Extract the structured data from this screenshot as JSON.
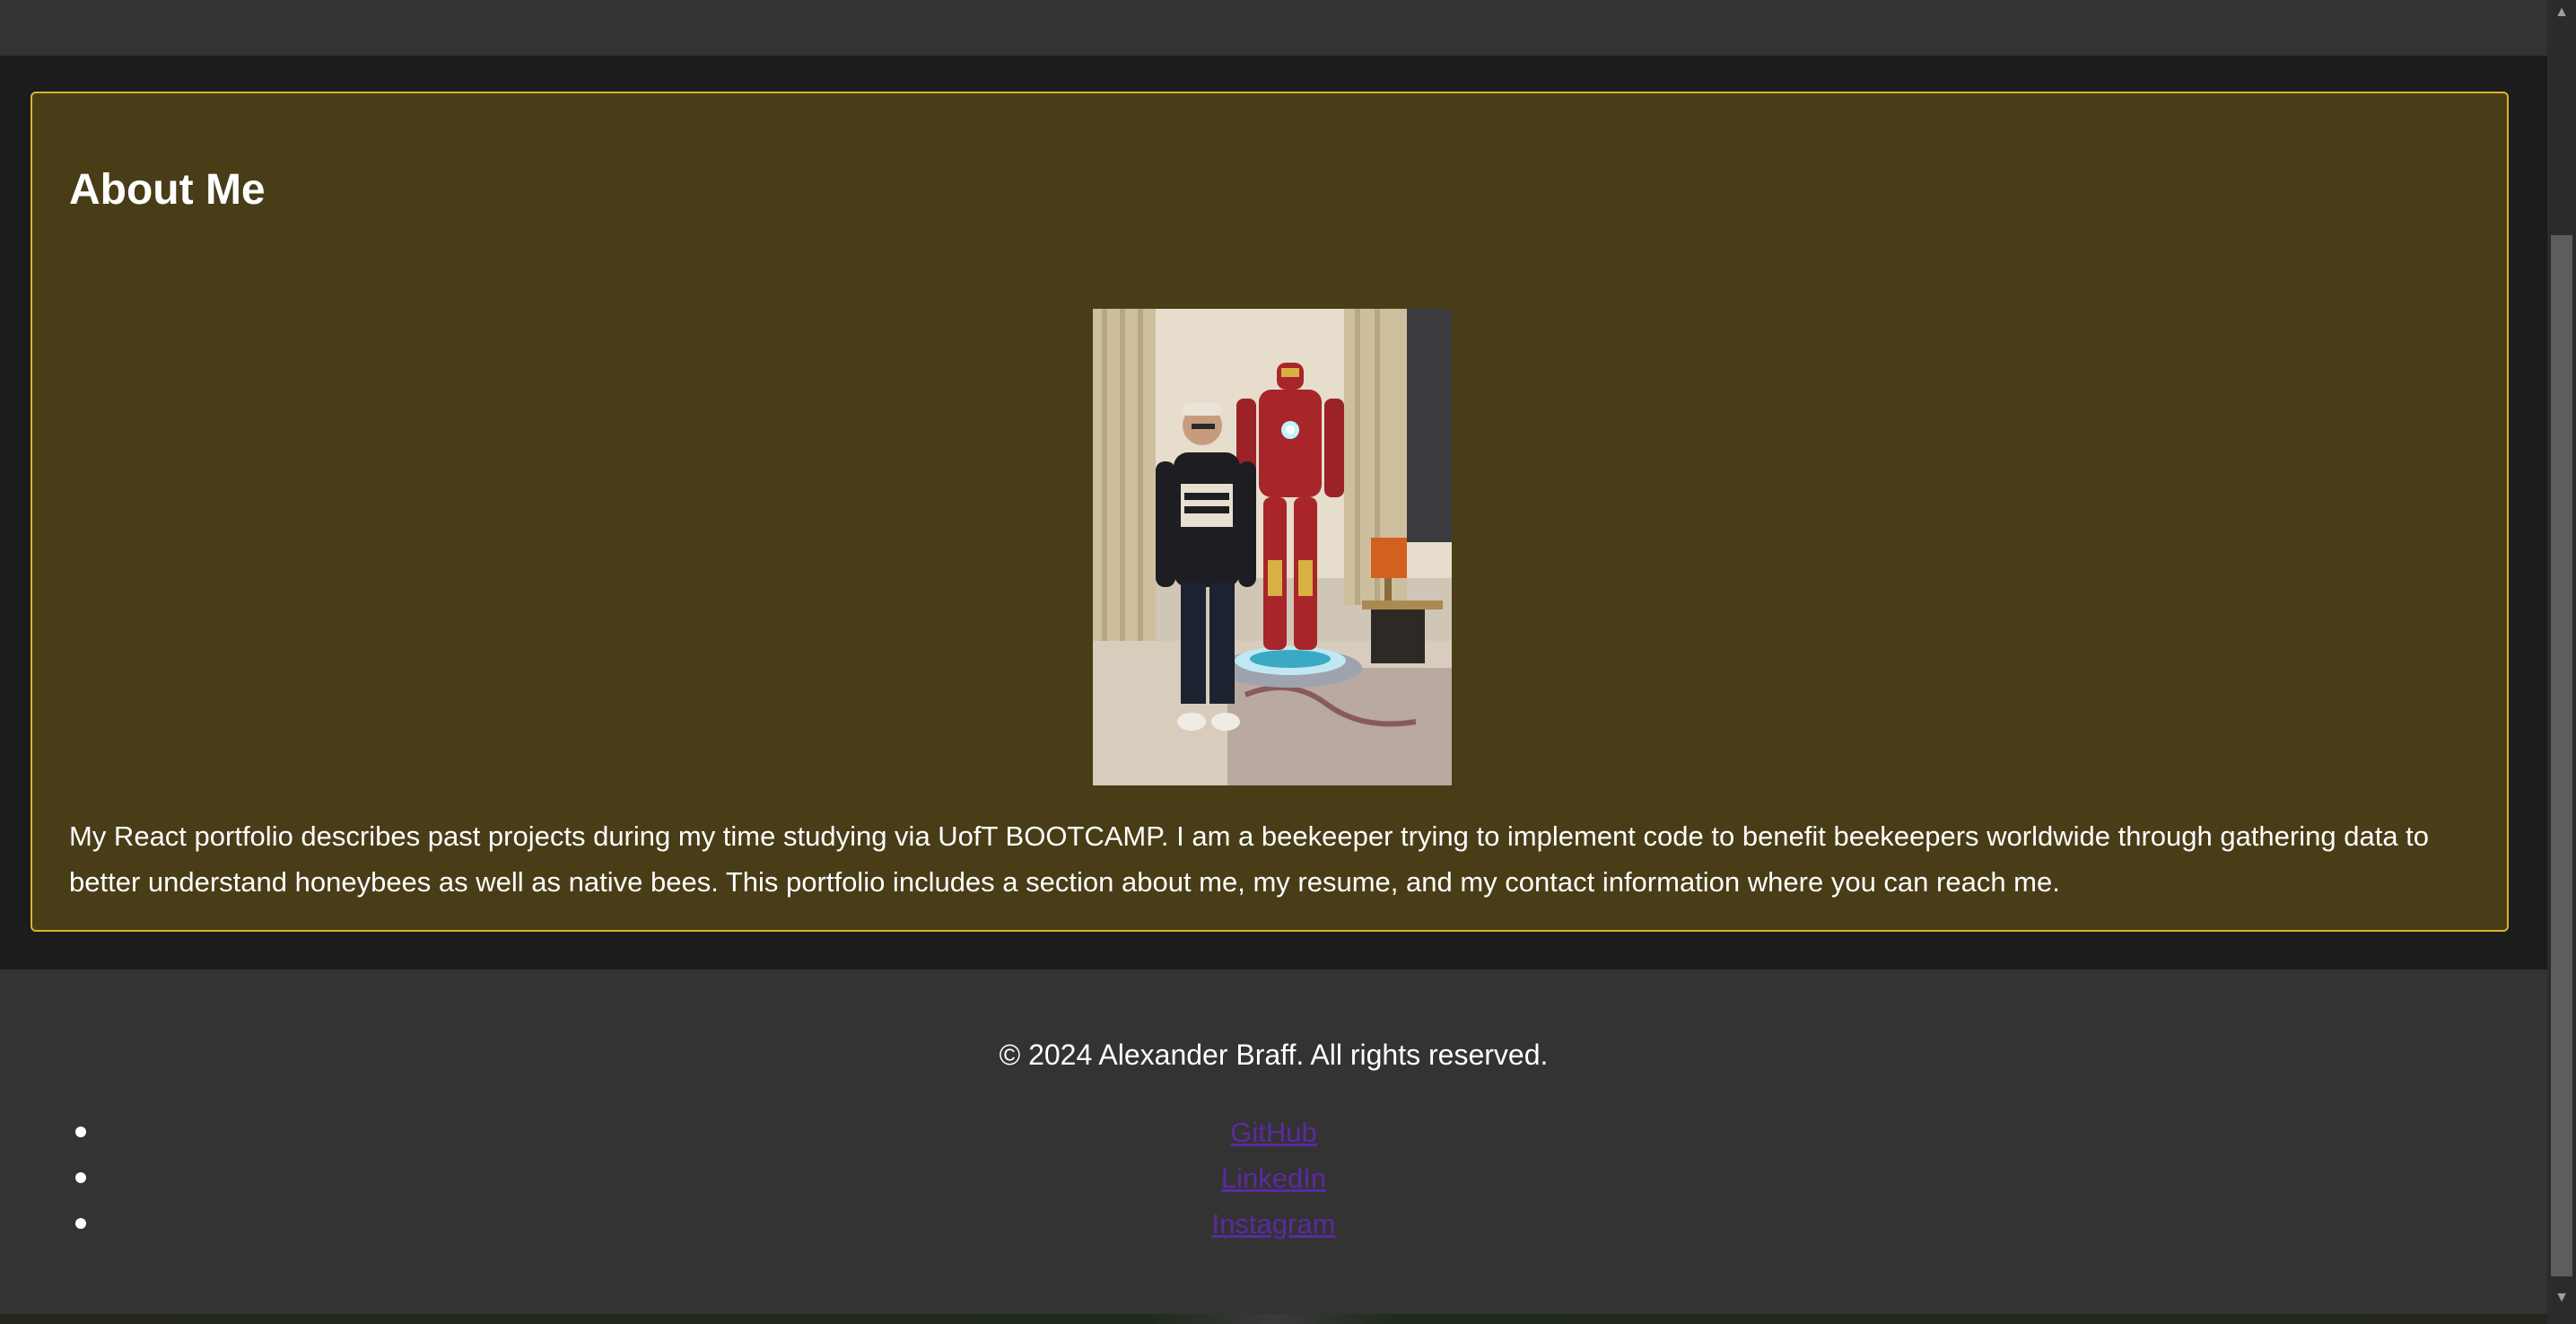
{
  "about": {
    "title": "About Me",
    "paragraph": "My React portfolio describes past projects during my time studying via UofT BOOTCAMP. I am a beekeeper trying to implement code to benefit beekeepers worldwide through gathering data to better understand honeybees as well as native bees. This portfolio includes a section about me, my resume, and my contact information where you can reach me."
  },
  "footer": {
    "copyright": "© 2024 Alexander Braff. All rights reserved.",
    "links": [
      {
        "label": "GitHub"
      },
      {
        "label": "LinkedIn"
      },
      {
        "label": "Instagram"
      }
    ]
  },
  "scrollbar": {
    "up_icon": "triangle-up-icon",
    "down_icon": "triangle-down-icon"
  },
  "colors": {
    "card_bg": "#483d17",
    "card_border": "#d9b42a",
    "footer_bg": "#333333",
    "link": "#5b2aa0"
  }
}
